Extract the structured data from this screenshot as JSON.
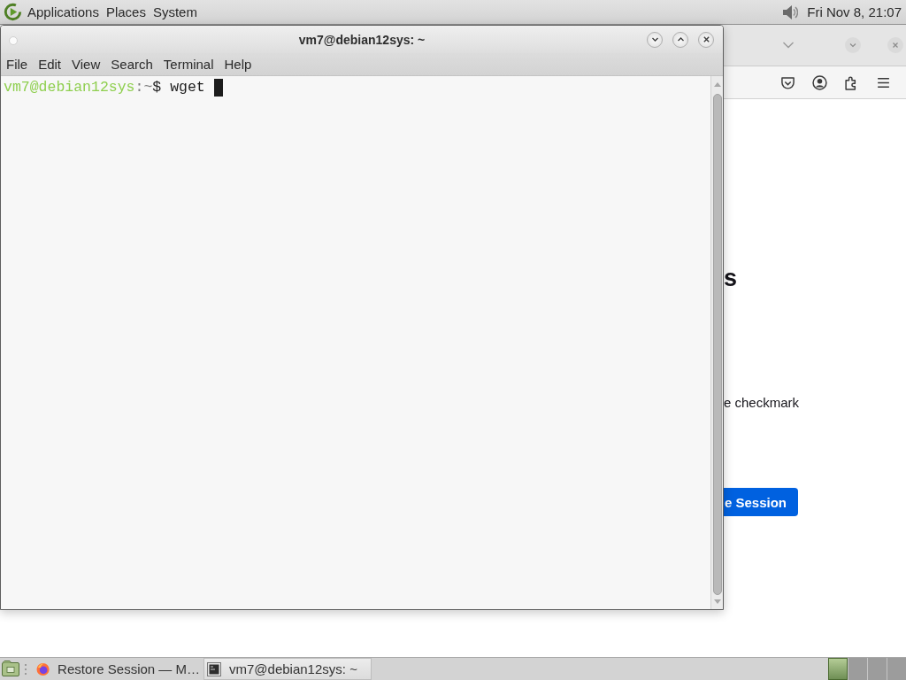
{
  "top_panel": {
    "menus": [
      "Applications",
      "Places",
      "System"
    ],
    "clock": "Fri Nov 8, 21:07"
  },
  "terminal_window": {
    "title": "vm7@debian12sys: ~",
    "menu": [
      "File",
      "Edit",
      "View",
      "Search",
      "Terminal",
      "Help"
    ],
    "lines": [
      {
        "segments": [
          {
            "kind": "user_host",
            "text": "vm7@debian12sys"
          },
          {
            "kind": "path",
            "text": ":~"
          },
          {
            "kind": "plain",
            "text": "$ wget"
          }
        ],
        "cursor": true
      }
    ]
  },
  "browser_window": {
    "heading": "s",
    "text": "e checkmark",
    "button": "e Session"
  },
  "taskbar": {
    "tasks": [
      {
        "kind": "browser",
        "label": "Restore Session — M…",
        "selected": false
      },
      {
        "kind": "terminal",
        "label": "vm7@debian12sys: ~",
        "selected": true
      }
    ],
    "workspaces": [
      {
        "selected": true
      },
      {
        "selected": false
      },
      {
        "selected": false
      },
      {
        "selected": false
      }
    ]
  }
}
